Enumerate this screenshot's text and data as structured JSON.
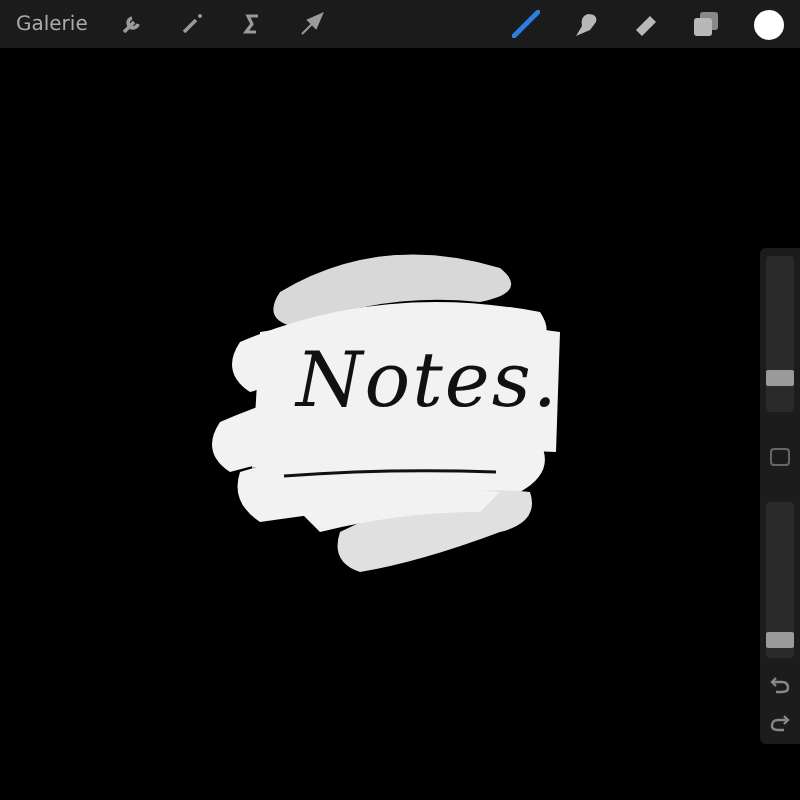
{
  "toolbar": {
    "gallery": "Galerie",
    "actions": [
      {
        "kind": "wrench"
      },
      {
        "kind": "wand"
      },
      {
        "kind": "selection"
      },
      {
        "kind": "move"
      }
    ],
    "tools": [
      {
        "kind": "brush",
        "selected": true
      },
      {
        "kind": "smudge",
        "selected": false
      },
      {
        "kind": "eraser",
        "selected": false
      },
      {
        "kind": "layers",
        "selected": false
      }
    ]
  },
  "canvas": {
    "text": "Notes."
  },
  "sidebar": {
    "size": {
      "level": 0.18
    },
    "opacity": {
      "level": 0.07
    }
  }
}
